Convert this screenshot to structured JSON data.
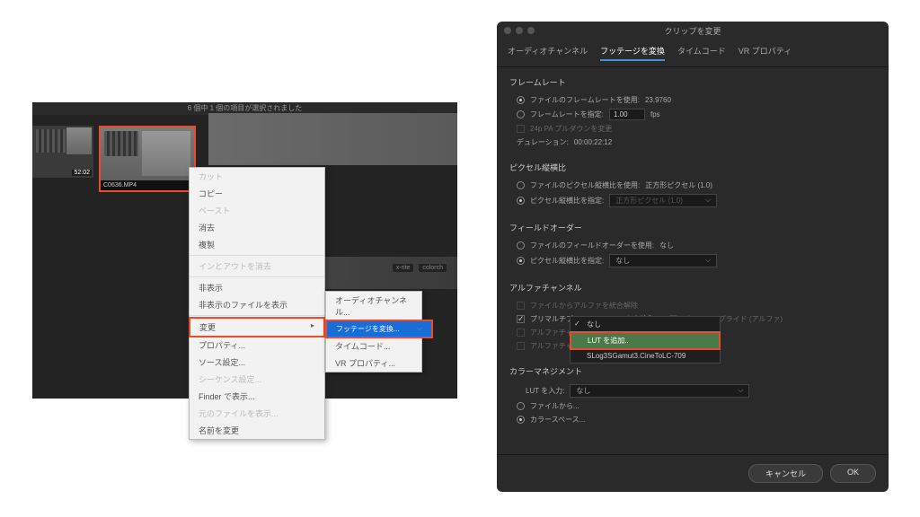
{
  "left": {
    "header": "6 個中 1 個の項目が選択されました",
    "thumb_ts": "52:02",
    "thumb_file": "C0636.MP4",
    "badges": [
      "x-rite",
      "colorch"
    ]
  },
  "ctx": {
    "cut": "カット",
    "copy": "コピー",
    "paste": "ペースト",
    "clear": "消去",
    "dup": "複製",
    "inout": "インとアウトを消去",
    "hide": "非表示",
    "showhidden": "非表示のファイルを表示",
    "modify": "変更",
    "properties": "プロパティ...",
    "source": "ソース設定...",
    "sequence": "シーケンス設定...",
    "finder": "Finder で表示...",
    "orig": "元のファイルを表示...",
    "rename": "名前を変更"
  },
  "sub": {
    "audio": "オーディオチャンネル...",
    "footage": "フッテージを変換...",
    "timecode": "タイムコード...",
    "vr": "VR プロパティ..."
  },
  "dialog": {
    "title": "クリップを変更",
    "tabs": [
      "オーディオチャンネル",
      "フッテージを変換",
      "タイムコード",
      "VR プロパティ"
    ],
    "framerate": {
      "title": "フレームレート",
      "use_file": "ファイルのフレームレートを使用:",
      "use_file_val": "23.9760",
      "assume": "フレームレートを指定:",
      "assume_val": "1.00",
      "fps": "fps",
      "remove": "24p PA プルダウンを変更",
      "duration": "デュレーション:",
      "duration_val": "00:00:22:12"
    },
    "par": {
      "title": "ピクセル縦横比",
      "use_file": "ファイルのピクセル縦横比を使用:",
      "use_file_val": "正方形ピクセル (1.0)",
      "conform": "ピクセル縦横比を指定:",
      "conform_val": "正方形ピクセル (1.0)"
    },
    "field": {
      "title": "フィールドオーダー",
      "use_file": "ファイルのフィールドオーダーを使用:",
      "use_file_val": "なし",
      "conform": "ピクセル縦横比を指定:",
      "conform_val": "なし"
    },
    "alpha": {
      "title": "アルファチャンネル",
      "ignore": "ファイルからアルファを統合解除",
      "premult": "プリマルチプライド アルファを直線化",
      "premult2": "プリマルチプライド (アルファ)",
      "proc": "アルファチャンネルを使用",
      "invert": "アルファチャンネルを反転"
    },
    "cm": {
      "title": "カラーマネジメント",
      "input": "LUT を入力:",
      "input_val": "なし",
      "from_file": "ファイルから...",
      "colorspace": "カラースペース..."
    },
    "cancel": "キャンセル",
    "ok": "OK"
  },
  "lut_dd": {
    "none": "なし",
    "add": "LUT を追加..",
    "preset": "SLog3SGamut3.CineToLC-709"
  }
}
